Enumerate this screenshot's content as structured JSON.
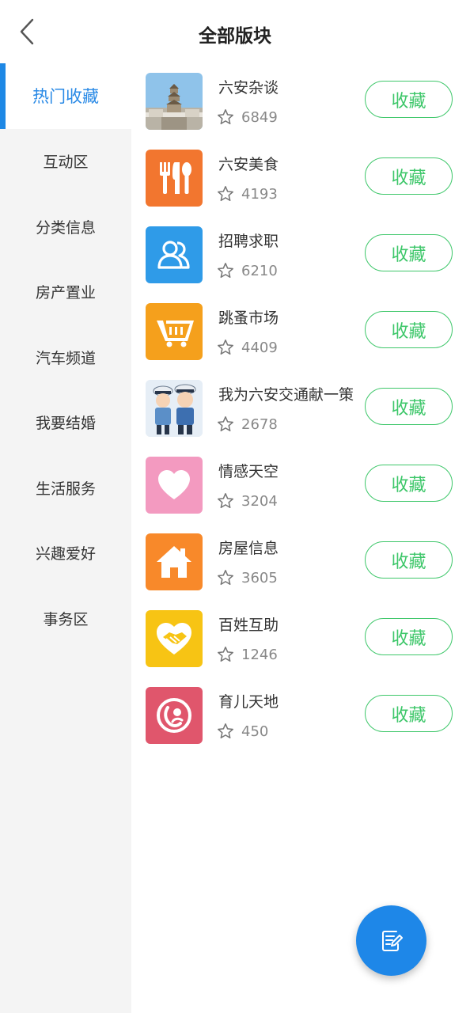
{
  "header": {
    "title": "全部版块"
  },
  "sidebar": {
    "items": [
      {
        "label": "热门收藏"
      },
      {
        "label": "互动区"
      },
      {
        "label": "分类信息"
      },
      {
        "label": "房产置业"
      },
      {
        "label": "汽车频道"
      },
      {
        "label": "我要结婚"
      },
      {
        "label": "生活服务"
      },
      {
        "label": "兴趣爱好"
      },
      {
        "label": "事务区"
      }
    ]
  },
  "forums": [
    {
      "name": "六安杂谈",
      "count": "6849",
      "action": "收藏",
      "icon": "pagoda-photo"
    },
    {
      "name": "六安美食",
      "count": "4193",
      "action": "收藏",
      "icon": "fork-knife-spoon-icon"
    },
    {
      "name": "招聘求职",
      "count": "6210",
      "action": "收藏",
      "icon": "people-icon"
    },
    {
      "name": "跳蚤市场",
      "count": "4409",
      "action": "收藏",
      "icon": "shopping-cart-icon"
    },
    {
      "name": "我为六安交通献一策",
      "count": "2678",
      "action": "收藏",
      "icon": "police-cartoon"
    },
    {
      "name": "情感天空",
      "count": "3204",
      "action": "收藏",
      "icon": "heart-icon"
    },
    {
      "name": "房屋信息",
      "count": "3605",
      "action": "收藏",
      "icon": "house-icon"
    },
    {
      "name": "百姓互助",
      "count": "1246",
      "action": "收藏",
      "icon": "heart-handshake-icon"
    },
    {
      "name": "育儿天地",
      "count": "450",
      "action": "收藏",
      "icon": "mother-child-icon"
    }
  ],
  "colors": {
    "accent": "#1e88e5",
    "fav_green": "#3ec76a",
    "icon_food": "#f2762f",
    "icon_jobs": "#2f9be8",
    "icon_market": "#f5a01c",
    "icon_love": "#f39ac0",
    "icon_house": "#f8892a",
    "icon_help": "#f7c414",
    "icon_parent": "#e0566c"
  }
}
